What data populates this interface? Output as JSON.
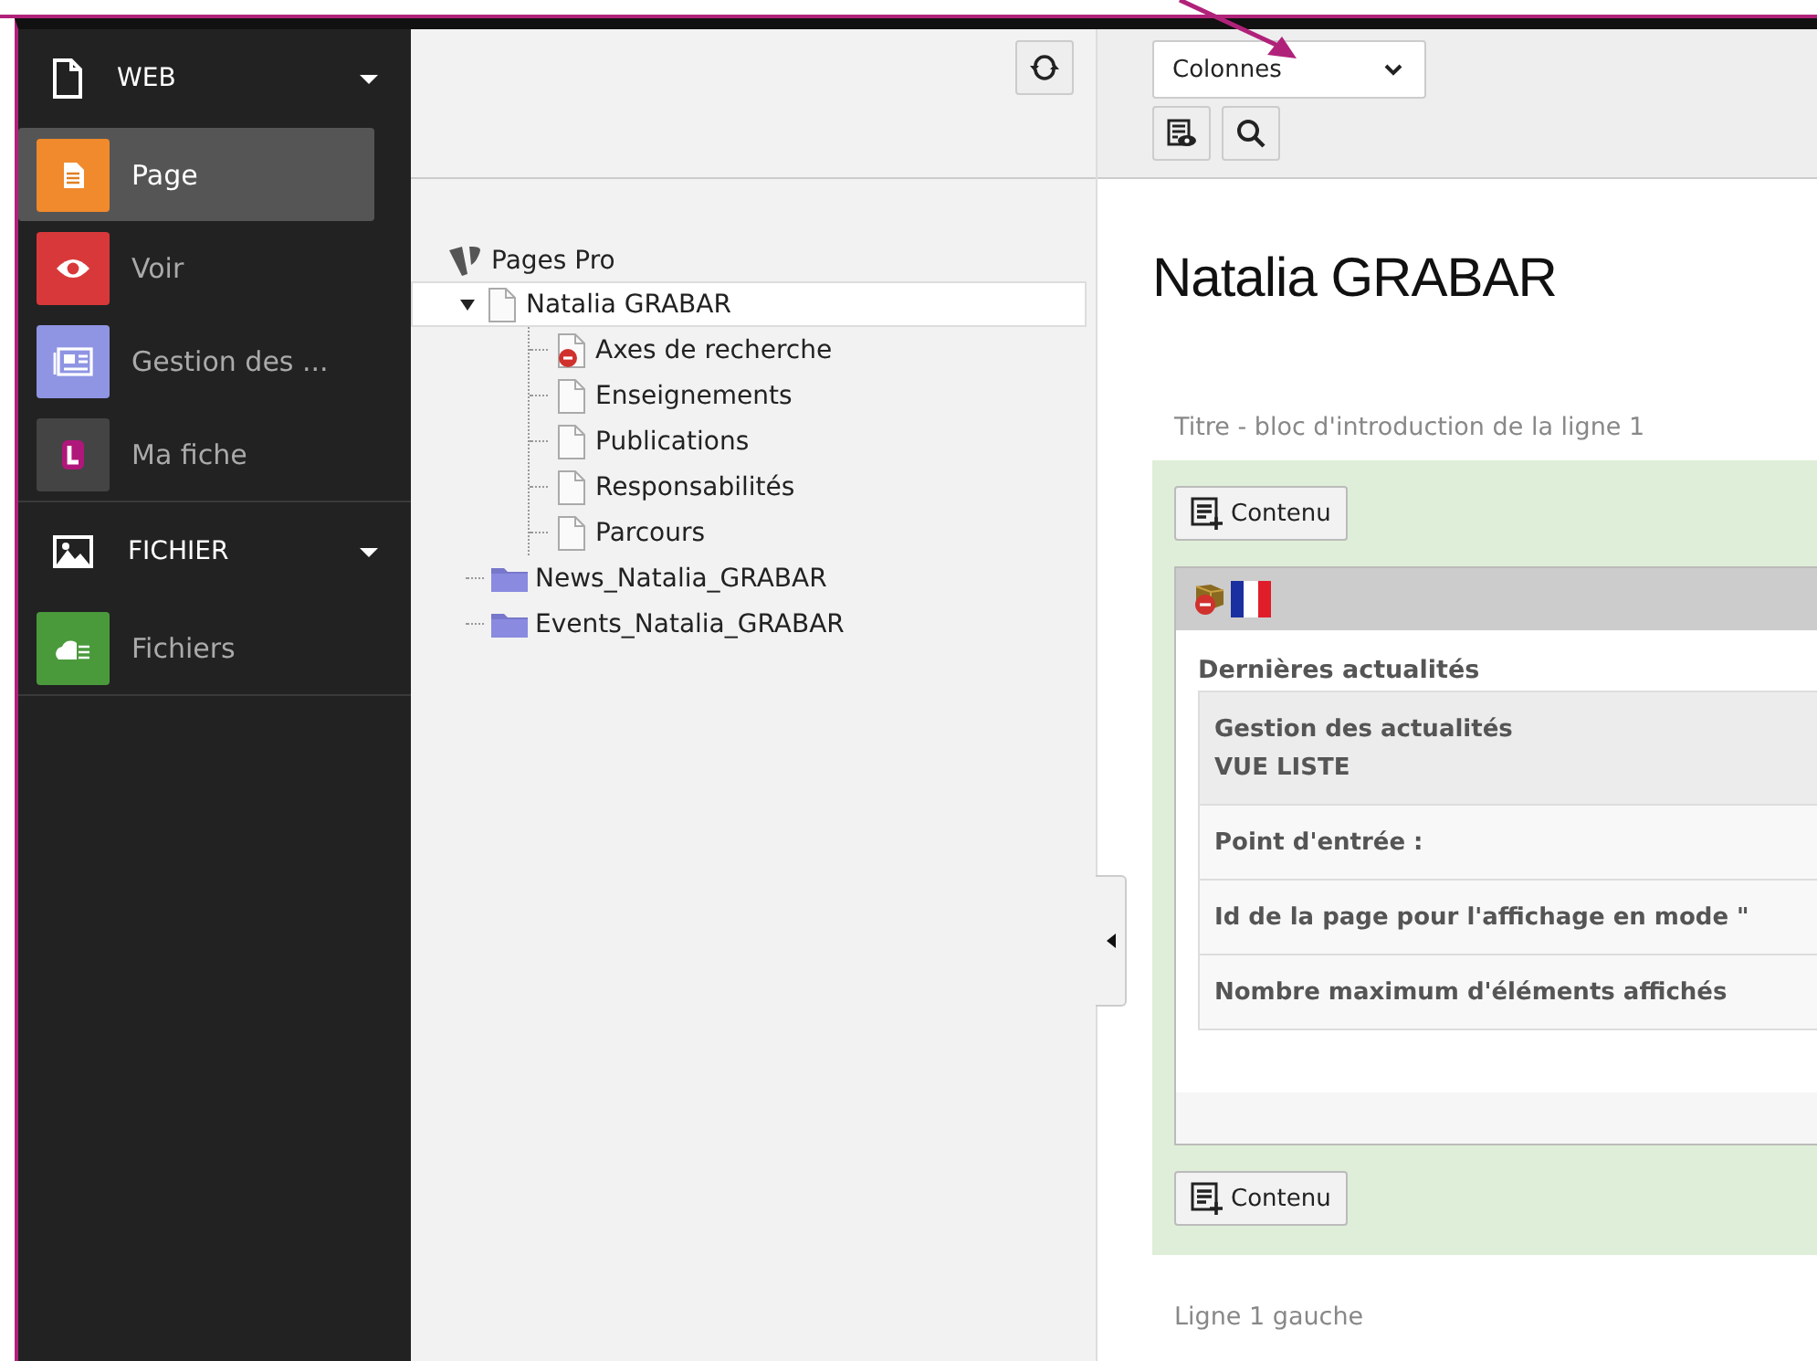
{
  "modules": [
    {
      "kind": "group",
      "label": "WEB",
      "expanded": true,
      "items": [
        {
          "label": "Page",
          "color": "#f08a2c",
          "selected": true
        },
        {
          "label": "Voir",
          "color": "#d9383a",
          "selected": false
        },
        {
          "label": "Gestion des ...",
          "color": "#8f95e3",
          "selected": false
        },
        {
          "label": "Ma fiche",
          "color": "#444444",
          "selected": false
        }
      ]
    },
    {
      "kind": "group",
      "label": "FICHIER",
      "expanded": true,
      "items": [
        {
          "label": "Fichiers",
          "color": "#4a9a3c",
          "selected": false
        }
      ]
    }
  ],
  "tree": {
    "root": "Pages Pro",
    "children": [
      {
        "label": "Natalia GRABAR",
        "kind": "page",
        "selected": true,
        "expanded": true,
        "children": [
          {
            "label": "Axes de recherche",
            "kind": "hidden",
            "selected": false
          },
          {
            "label": "Enseignements",
            "kind": "page",
            "selected": false
          },
          {
            "label": "Publications",
            "kind": "page",
            "selected": false
          },
          {
            "label": "Responsabilités",
            "kind": "page",
            "selected": false
          },
          {
            "label": "Parcours",
            "kind": "page",
            "selected": false
          }
        ]
      },
      {
        "label": "News_Natalia_GRABAR",
        "kind": "folder",
        "selected": false
      },
      {
        "label": "Events_Natalia_GRABAR",
        "kind": "folder",
        "selected": false
      }
    ]
  },
  "view_select": {
    "value": "Colonnes"
  },
  "page_title": "Natalia GRABAR",
  "sections": [
    {
      "label": "Titre - bloc d'introduction de la ligne 1",
      "new_content_buttons": [
        "Contenu",
        "Contenu"
      ],
      "element": {
        "title": "Dernières actualités",
        "hidden": true,
        "rows": [
          {
            "lines": [
              "Gestion des actualités",
              "VUE LISTE"
            ],
            "shaded": true
          },
          {
            "lines": [
              "Point d'entrée :"
            ],
            "shaded": false
          },
          {
            "lines": [
              "Id de la page pour l'affichage en mode \""
            ],
            "shaded": false
          },
          {
            "lines": [
              "Nombre maximum d'éléments affichés"
            ],
            "shaded": false
          }
        ]
      }
    },
    {
      "label": "Ligne 1 gauche"
    }
  ]
}
